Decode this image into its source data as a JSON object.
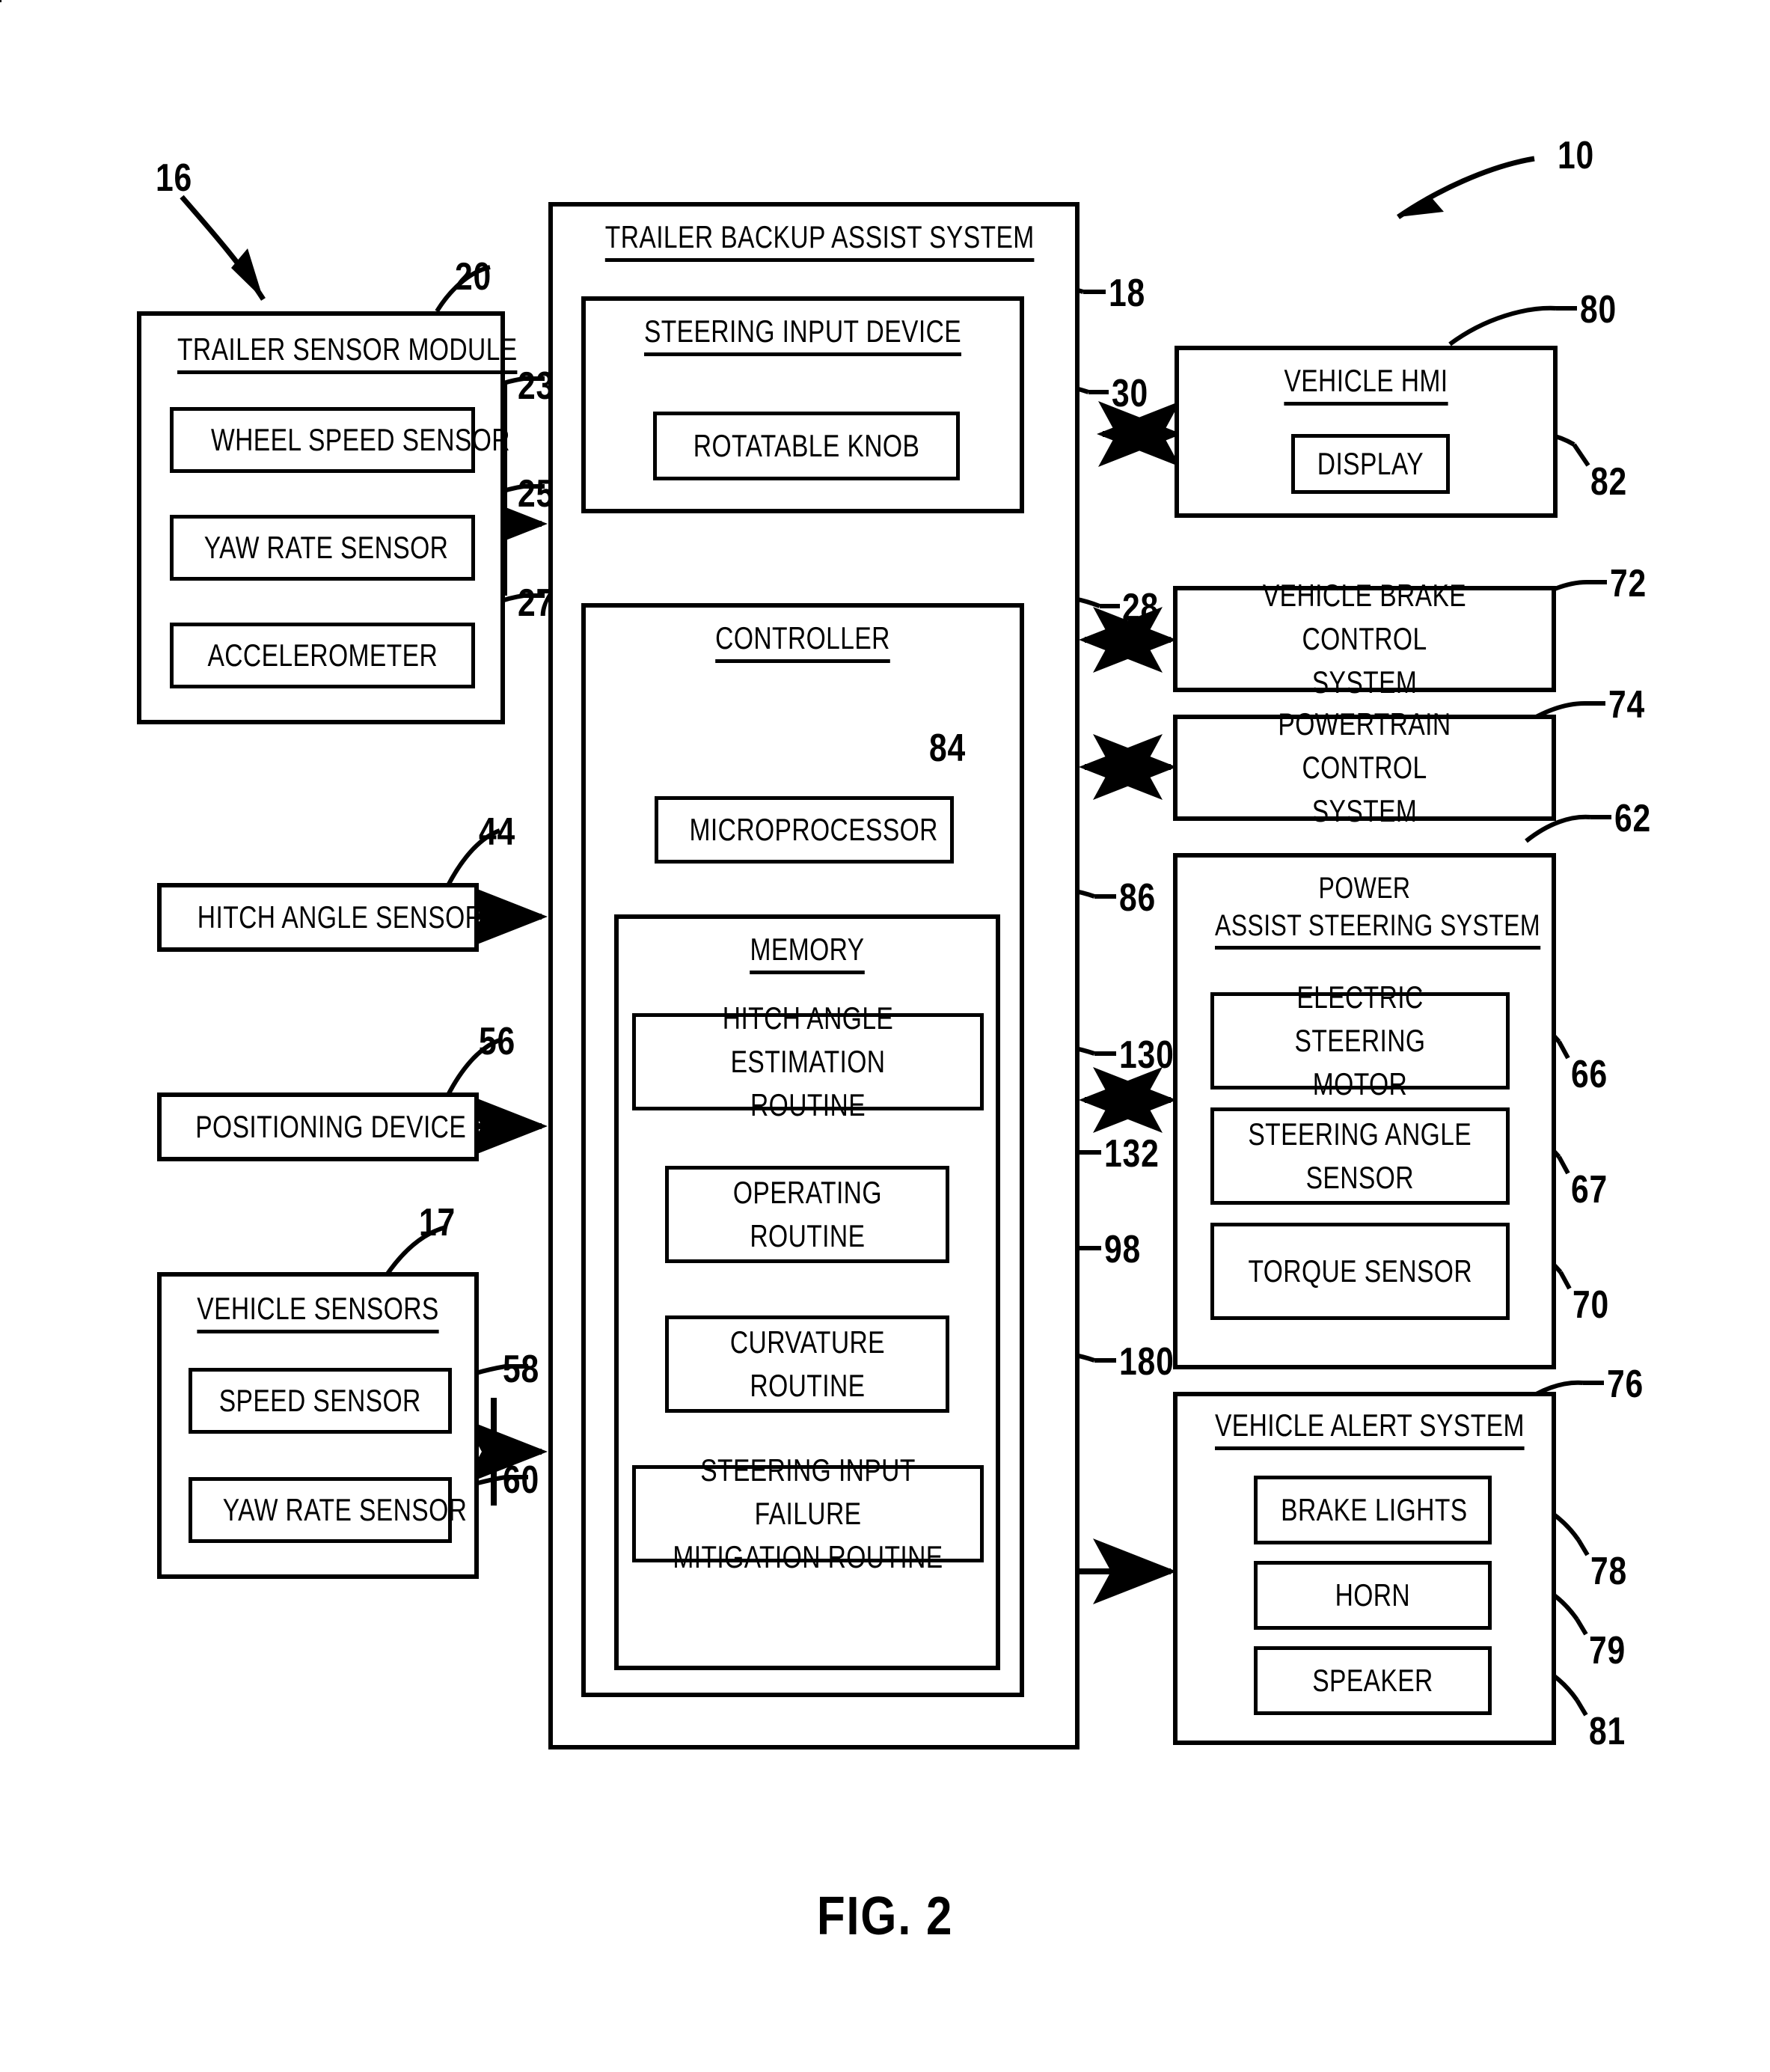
{
  "figure": {
    "caption": "FIG. 2",
    "system_ref": "10"
  },
  "left_column": {
    "trailer_sensor_module": {
      "title": "TRAILER SENSOR MODULE",
      "ref": "20",
      "group_ref": "16",
      "items": [
        {
          "label": "WHEEL SPEED SENSOR",
          "ref": "23"
        },
        {
          "label": "YAW RATE SENSOR",
          "ref": "25"
        },
        {
          "label": "ACCELEROMETER",
          "ref": "27"
        }
      ]
    },
    "hitch_angle_sensor": {
      "label": "HITCH ANGLE SENSOR",
      "ref": "44"
    },
    "positioning_device": {
      "label": "POSITIONING DEVICE",
      "ref": "56"
    },
    "vehicle_sensors": {
      "title": "VEHICLE SENSORS",
      "ref": "17",
      "items": [
        {
          "label": "SPEED SENSOR",
          "ref": "58"
        },
        {
          "label": "YAW RATE SENSOR",
          "ref": "60"
        }
      ]
    }
  },
  "center_column": {
    "trailer_backup_assist_system": {
      "title": "TRAILER BACKUP ASSIST SYSTEM",
      "steering_input_device": {
        "title": "STEERING INPUT DEVICE",
        "ref": "18",
        "rotatable_knob": {
          "label": "ROTATABLE KNOB",
          "ref": "30"
        }
      },
      "controller": {
        "title": "CONTROLLER",
        "ref": "28",
        "microprocessor": {
          "label": "MICROPROCESSOR",
          "ref": "84"
        },
        "memory": {
          "title": "MEMORY",
          "ref": "86",
          "routines": [
            {
              "label": "HITCH ANGLE ESTIMATION ROUTINE",
              "ref": "130"
            },
            {
              "label": "OPERATING ROUTINE",
              "ref": "132"
            },
            {
              "label": "CURVATURE ROUTINE",
              "ref": "98"
            },
            {
              "label": "STEERING INPUT FAILURE MITIGATION ROUTINE",
              "ref": "180"
            }
          ]
        }
      }
    }
  },
  "right_column": {
    "vehicle_hmi": {
      "title": "VEHICLE HMI",
      "ref": "80",
      "display": {
        "label": "DISPLAY",
        "ref": "82"
      }
    },
    "vehicle_brake_control_system": {
      "label": "VEHICLE BRAKE CONTROL SYSTEM",
      "ref": "72"
    },
    "powertrain_control_system": {
      "label": "POWERTRAIN CONTROL SYSTEM",
      "ref": "74"
    },
    "power_assist_steering_system": {
      "title": "POWER ASSIST STEERING SYSTEM",
      "ref": "62",
      "items": [
        {
          "label": "ELECTRIC STEERING MOTOR",
          "ref": "66"
        },
        {
          "label": "STEERING ANGLE SENSOR",
          "ref": "67"
        },
        {
          "label": "TORQUE SENSOR",
          "ref": "70"
        }
      ]
    },
    "vehicle_alert_system": {
      "title": "VEHICLE ALERT SYSTEM",
      "ref": "76",
      "items": [
        {
          "label": "BRAKE LIGHTS",
          "ref": "78"
        },
        {
          "label": "HORN",
          "ref": "79"
        },
        {
          "label": "SPEAKER",
          "ref": "81"
        }
      ]
    }
  }
}
